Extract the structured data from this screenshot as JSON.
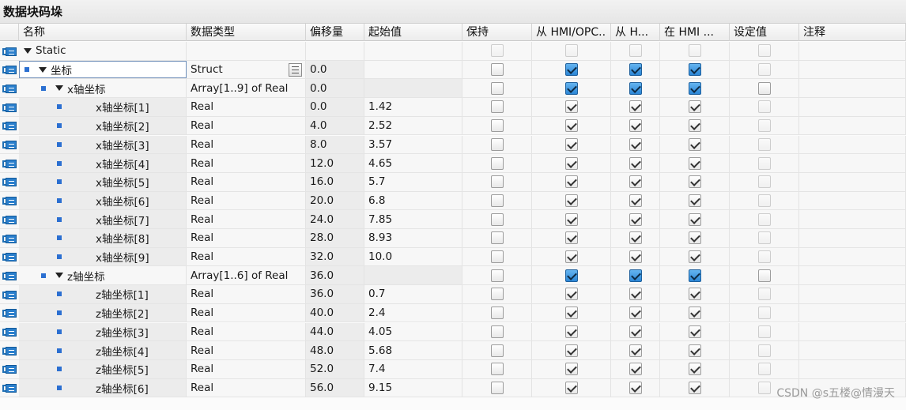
{
  "title": "数据块码垛",
  "columns": {
    "name": "名称",
    "type": "数据类型",
    "offset": "偏移量",
    "start": "起始值",
    "retain": "保持",
    "hmi_opc": "从 HMI/OPC..",
    "hmi_h": "从 H...",
    "hmi_in": "在 HMI ...",
    "setpoint": "设定值",
    "comment": "注释"
  },
  "rows": [
    {
      "name": "Static",
      "type": "",
      "offset": "",
      "start": ""
    },
    {
      "name": "坐标",
      "type": "Struct",
      "offset": "0.0",
      "start": ""
    },
    {
      "name": "x轴坐标",
      "type": "Array[1..9] of Real",
      "offset": "0.0",
      "start": ""
    },
    {
      "name": "x轴坐标[1]",
      "type": "Real",
      "offset": "0.0",
      "start": "1.42"
    },
    {
      "name": "x轴坐标[2]",
      "type": "Real",
      "offset": "4.0",
      "start": "2.52"
    },
    {
      "name": "x轴坐标[3]",
      "type": "Real",
      "offset": "8.0",
      "start": "3.57"
    },
    {
      "name": "x轴坐标[4]",
      "type": "Real",
      "offset": "12.0",
      "start": "4.65"
    },
    {
      "name": "x轴坐标[5]",
      "type": "Real",
      "offset": "16.0",
      "start": "5.7"
    },
    {
      "name": "x轴坐标[6]",
      "type": "Real",
      "offset": "20.0",
      "start": "6.8"
    },
    {
      "name": "x轴坐标[7]",
      "type": "Real",
      "offset": "24.0",
      "start": "7.85"
    },
    {
      "name": "x轴坐标[8]",
      "type": "Real",
      "offset": "28.0",
      "start": "8.93"
    },
    {
      "name": "x轴坐标[9]",
      "type": "Real",
      "offset": "32.0",
      "start": "10.0"
    },
    {
      "name": "z轴坐标",
      "type": "Array[1..6] of Real",
      "offset": "36.0",
      "start": ""
    },
    {
      "name": "z轴坐标[1]",
      "type": "Real",
      "offset": "36.0",
      "start": "0.7"
    },
    {
      "name": "z轴坐标[2]",
      "type": "Real",
      "offset": "40.0",
      "start": "2.4"
    },
    {
      "name": "z轴坐标[3]",
      "type": "Real",
      "offset": "44.0",
      "start": "4.05"
    },
    {
      "name": "z轴坐标[4]",
      "type": "Real",
      "offset": "48.0",
      "start": "5.68"
    },
    {
      "name": "z轴坐标[5]",
      "type": "Real",
      "offset": "52.0",
      "start": "7.4"
    },
    {
      "name": "z轴坐标[6]",
      "type": "Real",
      "offset": "56.0",
      "start": "9.15"
    }
  ],
  "watermark": "CSDN @s五楼@情漫天",
  "colors": {
    "accent": "#2b86d6",
    "row_bg": "#f7f7f7",
    "shade": "#ececec"
  }
}
